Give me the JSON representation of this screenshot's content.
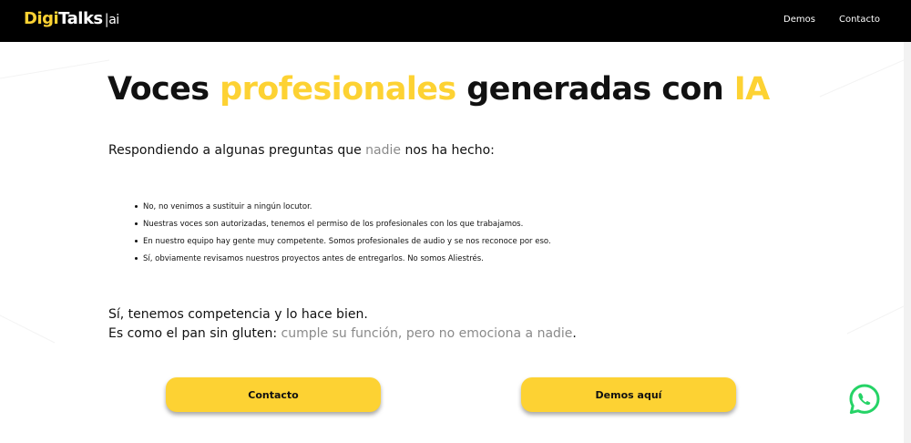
{
  "brand": {
    "logo_digi": "Digi",
    "logo_talks": "Talks",
    "logo_sep": "|",
    "logo_ai": "ai"
  },
  "nav": {
    "items": [
      {
        "label": "Demos"
      },
      {
        "label": "Contacto"
      }
    ]
  },
  "hero": {
    "part1": "Voces ",
    "highlight1": "profesionales",
    "part2": " generadas con ",
    "highlight2": "IA"
  },
  "intro": {
    "before": "Respondiendo a algunas preguntas que ",
    "muted": "nadie",
    "after": " nos ha hecho:"
  },
  "faq": [
    "No, no venimos a sustituir a ningún locutor.",
    "Nuestras voces son autorizadas, tenemos el permiso de los profesionales con los que trabajamos.",
    "En nuestro equipo hay gente muy competente. Somos profesionales de audio y se nos reconoce por eso.",
    "Sí, obviamente revisamos nuestros proyectos antes de entregarlos. No somos Aliestrés."
  ],
  "outro": {
    "line1": "Sí, tenemos competencia y lo hace bien.",
    "line2_before": "Es como el pan sin gluten: ",
    "line2_muted": "cumple su función, pero no emociona a nadie",
    "line2_after": "."
  },
  "buttons": {
    "contact_label": "Contacto",
    "demos_label": "Demos aquí"
  },
  "icons": {
    "whatsapp": "whatsapp-icon"
  },
  "colors": {
    "accent": "#fdd233",
    "navbar": "#000000",
    "muted_text": "#8a8a8a",
    "whatsapp": "#25d366"
  }
}
